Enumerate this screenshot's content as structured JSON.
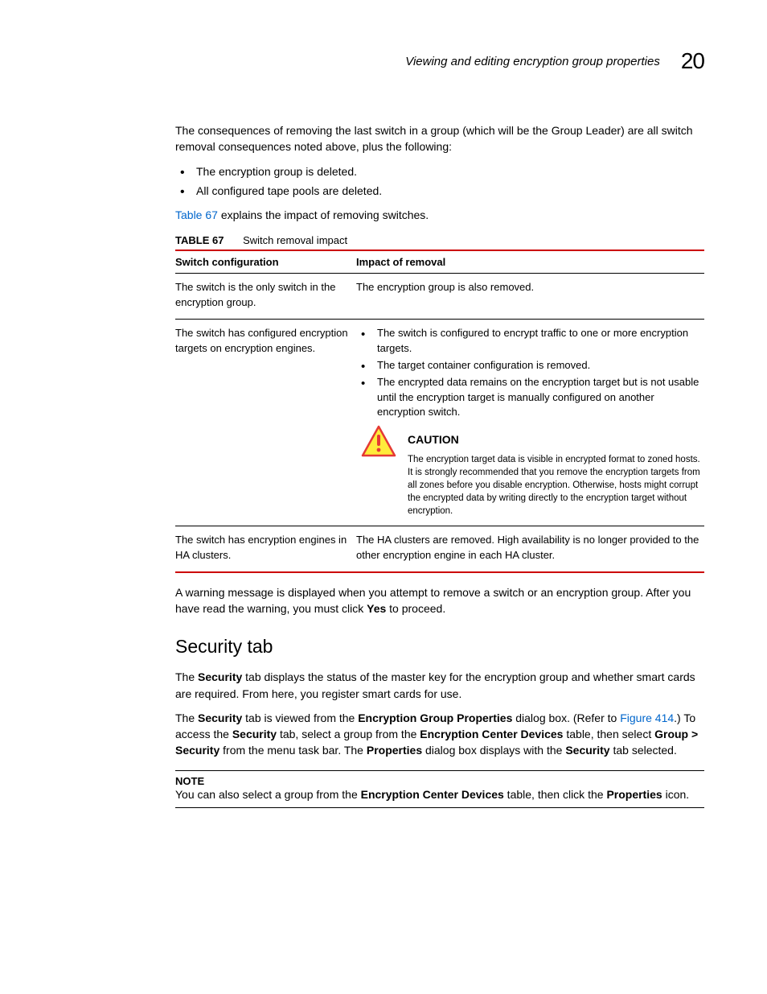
{
  "header": {
    "title": "Viewing and editing encryption group properties",
    "page_number": "20"
  },
  "intro_para": "The consequences of removing the last switch in a group (which will be the Group Leader) are all switch removal consequences noted above, plus the following:",
  "intro_bullets": [
    "The encryption group is deleted.",
    "All configured tape pools are deleted."
  ],
  "table_ref_sentence": {
    "link": "Table 67",
    "rest": " explains the impact of removing switches."
  },
  "table": {
    "label": "TABLE 67",
    "caption": "Switch removal impact",
    "head_col1": "Switch configuration",
    "head_col2": "Impact of removal",
    "rows": [
      {
        "config": "The switch is the only switch in the encryption group.",
        "impact_text": "The encryption group is also removed."
      },
      {
        "config": "The switch has configured encryption targets on encryption engines.",
        "impact_bullets": [
          "The switch is configured to encrypt traffic to one or more encryption targets.",
          "The target container configuration is removed.",
          "The encrypted data remains on the encryption target but is not usable until the encryption target is manually configured on another encryption switch."
        ],
        "caution": {
          "label": "CAUTION",
          "text": "The encryption target data is visible in encrypted format to zoned hosts. It is strongly recommended that you remove the encryption targets from all zones before you disable encryption. Otherwise, hosts might corrupt the encrypted data by writing directly to the encryption target without encryption."
        }
      },
      {
        "config": "The switch has encryption engines in HA clusters.",
        "impact_text": "The HA clusters are removed. High availability is no longer provided to the other encryption engine in each HA cluster."
      }
    ]
  },
  "after_table": {
    "pre": "A warning message is displayed when you attempt to remove a switch or an encryption group. After you have read the warning, you must click ",
    "bold": "Yes",
    "post": " to proceed."
  },
  "section_heading": "Security tab",
  "sec_p1": {
    "t1": "The ",
    "b1": "Security",
    "t2": " tab displays the status of the master key for the encryption group and whether smart cards are required. From here, you register smart cards for use."
  },
  "sec_p2": {
    "t1": "The ",
    "b1": "Security",
    "t2": " tab is viewed from the ",
    "b2": "Encryption Group Properties",
    "t3": " dialog box. (Refer to ",
    "link": "Figure 414",
    "t4": ".) To access the ",
    "b3": "Security",
    "t5": " tab, select a group from the ",
    "b4": "Encryption Center Devices",
    "t6": " table, then select ",
    "b5": "Group > Security",
    "t7": " from the menu task bar. The ",
    "b6": "Properties",
    "t8": " dialog box displays with the ",
    "b7": "Security",
    "t9": " tab selected."
  },
  "note": {
    "label": "NOTE",
    "t1": "You can also select a group from the ",
    "b1": "Encryption Center Devices",
    "t2": " table, then click the ",
    "b2": "Properties",
    "t3": " icon."
  }
}
